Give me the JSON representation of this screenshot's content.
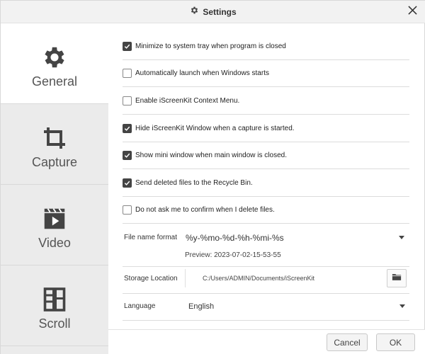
{
  "window": {
    "title": "Settings"
  },
  "sidebar": {
    "items": [
      {
        "label": "General",
        "icon": "gear-icon",
        "active": true
      },
      {
        "label": "Capture",
        "icon": "crop-icon",
        "active": false
      },
      {
        "label": "Video",
        "icon": "video-icon",
        "active": false
      },
      {
        "label": "Scroll",
        "icon": "scroll-icon",
        "active": false
      }
    ]
  },
  "options": [
    {
      "label": "Minimize to system tray when program is closed",
      "checked": true
    },
    {
      "label": "Automatically launch when Windows starts",
      "checked": false
    },
    {
      "label": "Enable iScreenKit Context Menu.",
      "checked": false
    },
    {
      "label": "Hide iScreenKit Window when a capture is started.",
      "checked": true
    },
    {
      "label": "Show mini window when main window is closed.",
      "checked": true
    },
    {
      "label": "Send deleted files to the Recycle Bin.",
      "checked": true
    },
    {
      "label": "Do not ask me to confirm when I delete files.",
      "checked": false
    }
  ],
  "file_name_format": {
    "label": "File name format",
    "value": "%y-%mo-%d-%h-%mi-%s",
    "preview": "Preview: 2023-07-02-15-53-55"
  },
  "storage": {
    "label": "Storage Location",
    "path": "C:/Users/ADMIN/Documents/iScreenKit"
  },
  "language": {
    "label": "Language",
    "value": "English"
  },
  "footer": {
    "cancel_label": "Cancel",
    "ok_label": "OK"
  }
}
